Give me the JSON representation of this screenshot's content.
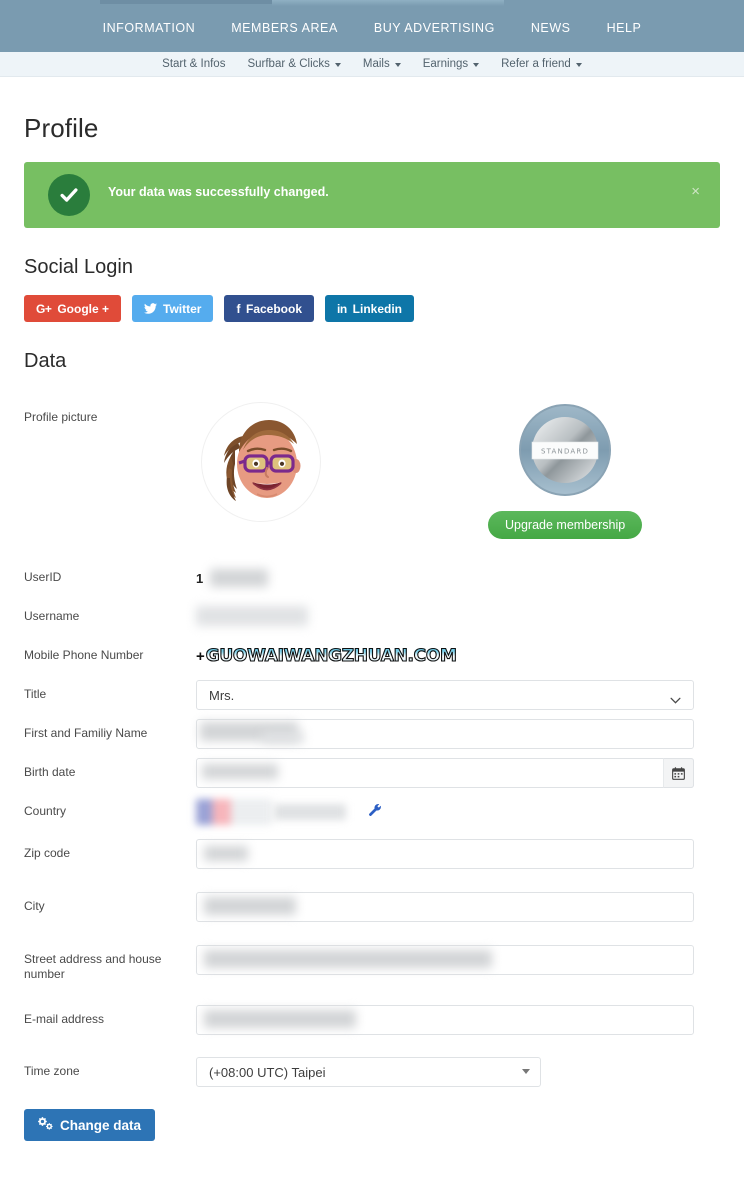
{
  "topnav": {
    "items": [
      {
        "label": "INFORMATION",
        "name": "topnav-information"
      },
      {
        "label": "MEMBERS AREA",
        "name": "topnav-members-area"
      },
      {
        "label": "BUY ADVERTISING",
        "name": "topnav-buy-advertising"
      },
      {
        "label": "NEWS",
        "name": "topnav-news"
      },
      {
        "label": "HELP",
        "name": "topnav-help"
      }
    ]
  },
  "subnav": {
    "items": [
      {
        "label": "Start & Infos",
        "caret": false
      },
      {
        "label": "Surfbar & Clicks",
        "caret": true
      },
      {
        "label": "Mails",
        "caret": true
      },
      {
        "label": "Earnings",
        "caret": true
      },
      {
        "label": "Refer a friend",
        "caret": true
      }
    ]
  },
  "page": {
    "title": "Profile"
  },
  "alert": {
    "message": "Your data was successfully changed.",
    "close_label": "×",
    "bg_color": "#77bf62",
    "icon_color": "#2a7d3c"
  },
  "social": {
    "heading": "Social Login",
    "buttons": [
      {
        "label": "Google +",
        "glyph": "G+",
        "color": "#e04b39",
        "name": "google-login-button"
      },
      {
        "label": "Twitter",
        "glyph": "twitter-icon",
        "color": "#55acee",
        "name": "twitter-login-button"
      },
      {
        "label": "Facebook",
        "glyph": "f",
        "color": "#31508f",
        "name": "facebook-login-button"
      },
      {
        "label": "Linkedin",
        "glyph": "in",
        "color": "#0e76a8",
        "name": "linkedin-login-button"
      }
    ]
  },
  "data_section": {
    "heading": "Data",
    "profile_picture_label": "Profile picture",
    "membership": {
      "tier": "STANDARD",
      "upgrade_label": "Upgrade membership"
    },
    "fields": {
      "userid_label": "UserID",
      "userid_value": "1",
      "username_label": "Username",
      "phone_label": "Mobile Phone Number",
      "phone_value": "GUOWAIWANGZHUAN.COM",
      "phone_prefix": "+",
      "title_label": "Title",
      "title_value": "Mrs.",
      "name_label": "First and Familiy Name",
      "birth_label": "Birth date",
      "country_label": "Country",
      "zip_label": "Zip code",
      "city_label": "City",
      "street_label": "Street address and house number",
      "email_label": "E-mail address",
      "timezone_label": "Time zone",
      "timezone_value": "(+08:00 UTC) Taipei"
    }
  },
  "footer": {
    "change_button_label": "Change data",
    "change_button_color": "#2d74b5"
  }
}
